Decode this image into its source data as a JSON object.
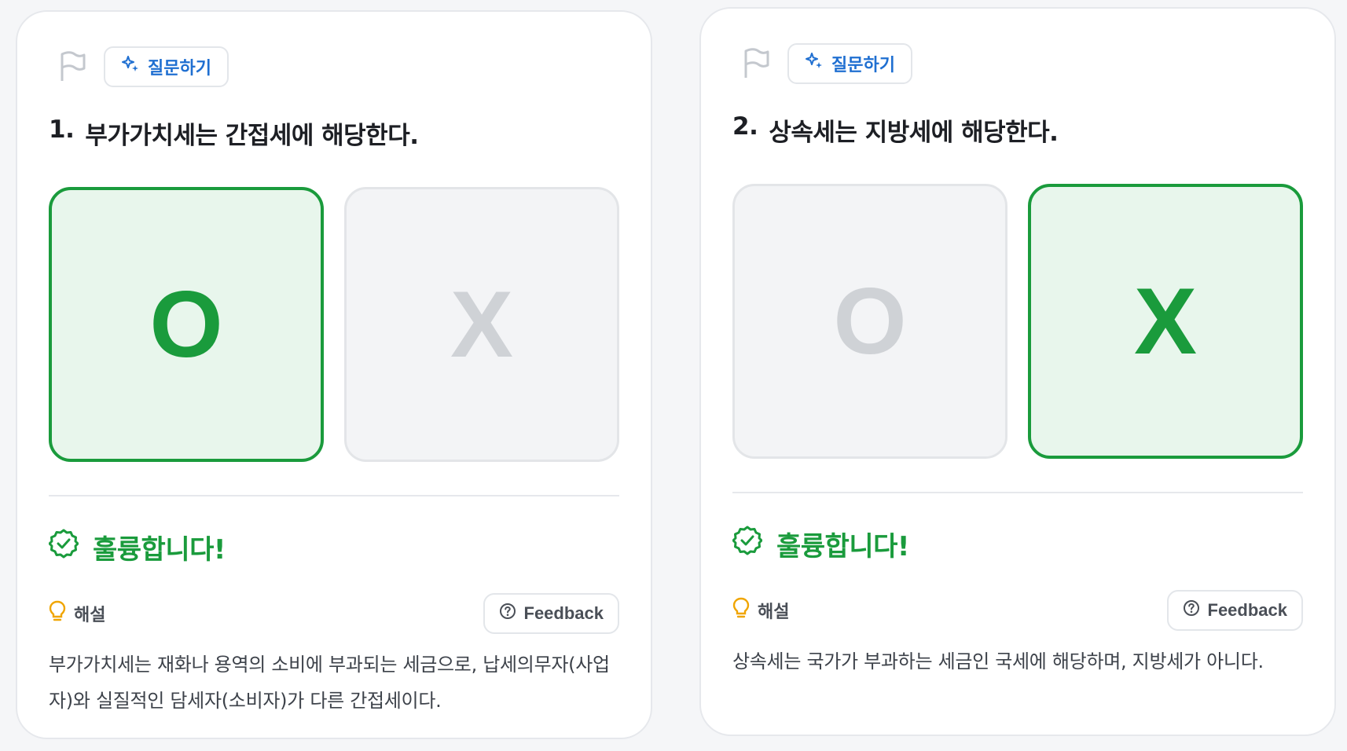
{
  "colors": {
    "accent_green": "#1a9b3c",
    "accent_blue": "#1f6fd1",
    "neutral_mark": "#cfd2d6"
  },
  "cards": [
    {
      "ask_label": "질문하기",
      "number": "1.",
      "question": "부가가치세는 간접세에 해당한다.",
      "choice_o": "O",
      "choice_x": "X",
      "selected": "O",
      "result": "훌륭합니다!",
      "explain_label": "해설",
      "feedback_label": "Feedback",
      "explanation": "부가가치세는 재화나 용역의 소비에 부과되는 세금으로, 납세의무자(사업자)와 실질적인 담세자(소비자)가 다른 간접세이다."
    },
    {
      "ask_label": "질문하기",
      "number": "2.",
      "question": "상속세는 지방세에 해당한다.",
      "choice_o": "O",
      "choice_x": "X",
      "selected": "X",
      "result": "훌륭합니다!",
      "explain_label": "해설",
      "feedback_label": "Feedback",
      "explanation": "상속세는 국가가 부과하는 세금인 국세에 해당하며, 지방세가 아니다."
    }
  ],
  "icons": {
    "flag": "flag-icon",
    "sparkle": "sparkle-icon",
    "check": "check-badge-icon",
    "bulb": "lightbulb-icon",
    "help": "question-circle-icon"
  }
}
